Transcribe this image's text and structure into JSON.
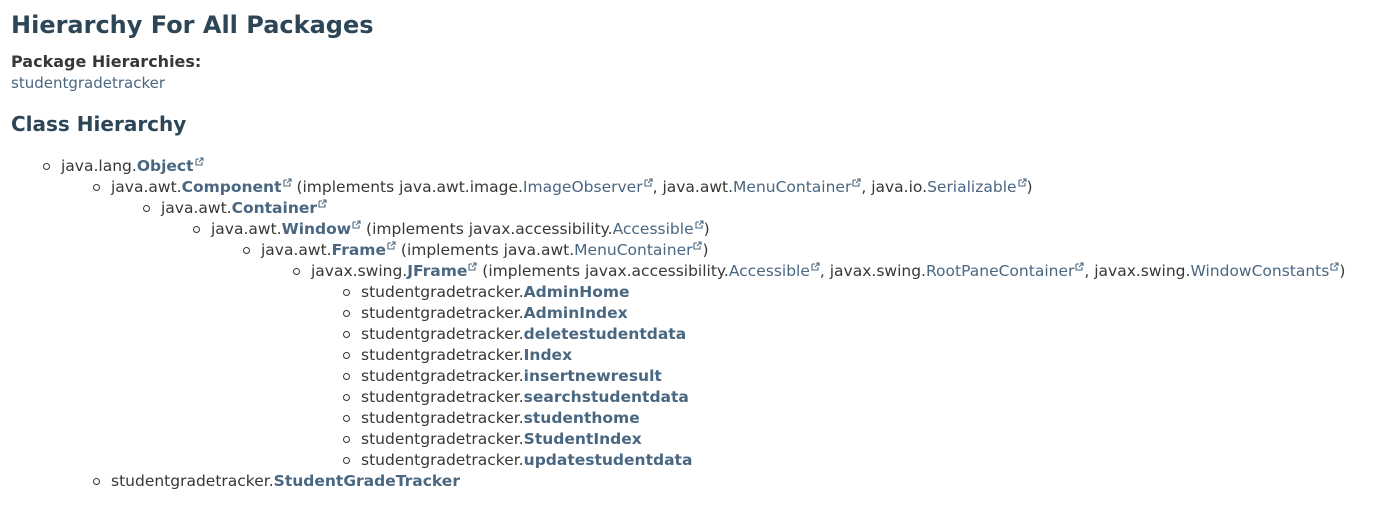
{
  "header": {
    "title": "Hierarchy For All Packages",
    "package_label": "Package Hierarchies:",
    "package_link": "studentgradetracker"
  },
  "section_title": "Class Hierarchy",
  "tree": [
    {
      "level": 0,
      "pkg": "java.lang.",
      "cls": "Object",
      "external": true,
      "implements": []
    },
    {
      "level": 1,
      "pkg": "java.awt.",
      "cls": "Component",
      "external": true,
      "implements": [
        {
          "pkg": "java.awt.image.",
          "name": "ImageObserver"
        },
        {
          "pkg": "java.awt.",
          "name": "MenuContainer"
        },
        {
          "pkg": "java.io.",
          "name": "Serializable"
        }
      ]
    },
    {
      "level": 2,
      "pkg": "java.awt.",
      "cls": "Container",
      "external": true,
      "implements": []
    },
    {
      "level": 3,
      "pkg": "java.awt.",
      "cls": "Window",
      "external": true,
      "implements": [
        {
          "pkg": "javax.accessibility.",
          "name": "Accessible"
        }
      ]
    },
    {
      "level": 4,
      "pkg": "java.awt.",
      "cls": "Frame",
      "external": true,
      "implements": [
        {
          "pkg": "java.awt.",
          "name": "MenuContainer"
        }
      ]
    },
    {
      "level": 5,
      "pkg": "javax.swing.",
      "cls": "JFrame",
      "external": true,
      "implements": [
        {
          "pkg": "javax.accessibility.",
          "name": "Accessible"
        },
        {
          "pkg": "javax.swing.",
          "name": "RootPaneContainer"
        },
        {
          "pkg": "javax.swing.",
          "name": "WindowConstants"
        }
      ]
    },
    {
      "level": 6,
      "pkg": "studentgradetracker.",
      "cls": "AdminHome",
      "external": false,
      "implements": []
    },
    {
      "level": 6,
      "pkg": "studentgradetracker.",
      "cls": "AdminIndex",
      "external": false,
      "implements": []
    },
    {
      "level": 6,
      "pkg": "studentgradetracker.",
      "cls": "deletestudentdata",
      "external": false,
      "implements": []
    },
    {
      "level": 6,
      "pkg": "studentgradetracker.",
      "cls": "Index",
      "external": false,
      "implements": []
    },
    {
      "level": 6,
      "pkg": "studentgradetracker.",
      "cls": "insertnewresult",
      "external": false,
      "implements": []
    },
    {
      "level": 6,
      "pkg": "studentgradetracker.",
      "cls": "searchstudentdata",
      "external": false,
      "implements": []
    },
    {
      "level": 6,
      "pkg": "studentgradetracker.",
      "cls": "studenthome",
      "external": false,
      "implements": []
    },
    {
      "level": 6,
      "pkg": "studentgradetracker.",
      "cls": "StudentIndex",
      "external": false,
      "implements": []
    },
    {
      "level": 6,
      "pkg": "studentgradetracker.",
      "cls": "updatestudentdata",
      "external": false,
      "implements": []
    },
    {
      "level": 1,
      "pkg": "studentgradetracker.",
      "cls": "StudentGradeTracker",
      "external": false,
      "implements": []
    }
  ],
  "strings": {
    "implements_open": " (implements ",
    "separator": ", ",
    "close": ")"
  },
  "colors": {
    "heading": "#2c4557",
    "link": "#4a6782",
    "text": "#353833"
  },
  "icons": {
    "external_link": "external-link-icon",
    "bullet": "bullet-icon"
  }
}
